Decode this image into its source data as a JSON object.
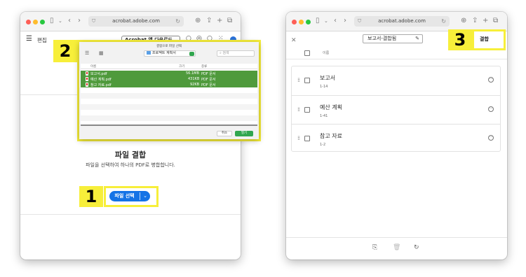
{
  "left_window": {
    "url": "acrobat.adobe.com",
    "app": {
      "edit_label": "편집",
      "open_app_label": "Acrobat 앱 다운로드"
    },
    "title": "파일 결합",
    "subtitle": "파일을 선택하여 하나의 PDF로 병합합니다.",
    "select_button_label": "파일 선택"
  },
  "dialog": {
    "title": "결합으로 파일 선택",
    "location": "프로젝트 계획서",
    "search_placeholder": "검색",
    "columns": [
      "이름",
      "크기",
      "종류"
    ],
    "files": [
      {
        "name": "보고서.pdf",
        "size": "56.1MB",
        "kind": "PDF 문서"
      },
      {
        "name": "예산 계획.pdf",
        "size": "431KB",
        "kind": "PDF 문서"
      },
      {
        "name": "참고 자료.pdf",
        "size": "92KB",
        "kind": "PDF 문서"
      }
    ],
    "cancel_label": "취소",
    "open_label": "열기"
  },
  "right_window": {
    "url": "acrobat.adobe.com",
    "filename": "보고서-결합됨",
    "combine_label": "결합",
    "column_name": "이름",
    "files": [
      {
        "name": "보고서",
        "pages": "1-14"
      },
      {
        "name": "예산 계획",
        "pages": "1-41"
      },
      {
        "name": "참고 자료",
        "pages": "1-2"
      }
    ]
  },
  "steps": {
    "one": "1",
    "two": "2",
    "three": "3"
  },
  "colors": {
    "highlight": "#f7ef3a",
    "primary_button": "#1473e6",
    "selected_row": "#4f9a3c",
    "open_button": "#31a64e"
  },
  "icons": {
    "menu": "menu-icon",
    "sidebar": "sidebar-icon",
    "back": "back-icon",
    "forward": "forward-icon",
    "shield": "shield-icon",
    "reload": "reload-icon",
    "download": "download-icon",
    "share": "share-icon",
    "new_tab": "plus-icon",
    "tabs": "tabs-icon",
    "pdf": "pdf-file-icon",
    "close": "close-icon",
    "edit": "pencil-icon",
    "drag": "drag-handle-icon",
    "more": "more-icon",
    "add_files": "add-file-icon",
    "delete": "trash-icon",
    "rotate": "rotate-icon"
  }
}
